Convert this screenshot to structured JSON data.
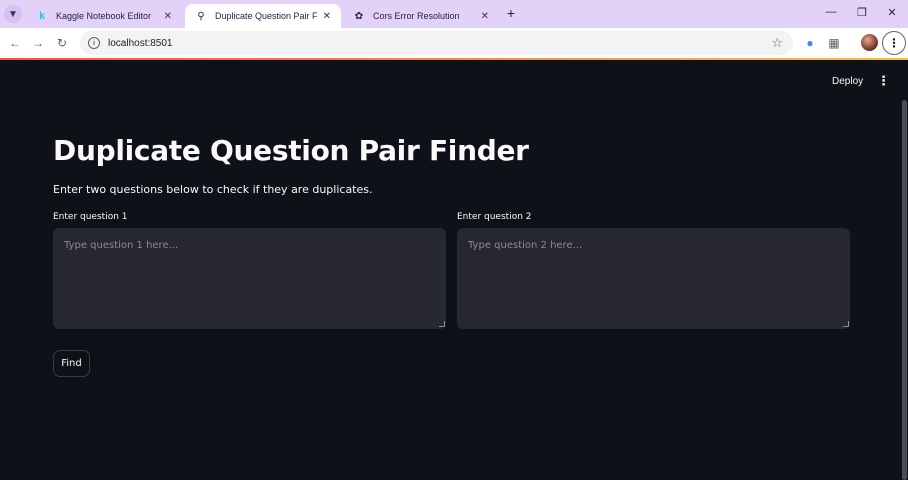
{
  "browser": {
    "tabs": [
      {
        "label": "Kaggle Notebook Editor",
        "favicon": "kaggle-k-icon",
        "active": false
      },
      {
        "label": "Duplicate Question Pair Finder",
        "favicon": "search-icon",
        "active": true
      },
      {
        "label": "Cors Error Resolution",
        "favicon": "openai-icon",
        "active": false
      }
    ],
    "url": "localhost:8501",
    "colors": {
      "tabstrip": "#e3d2f7",
      "toolbar": "#ffffff"
    }
  },
  "app": {
    "deploy_label": "Deploy",
    "title": "Duplicate Question Pair Finder",
    "subtitle": "Enter two questions below to check if they are duplicates.",
    "question1": {
      "label": "Enter question 1",
      "placeholder": "Type question 1 here...",
      "value": ""
    },
    "question2": {
      "label": "Enter question 2",
      "placeholder": "Type question 2 here...",
      "value": ""
    },
    "find_label": "Find",
    "colors": {
      "background": "#0e1117",
      "input": "#262730",
      "text": "#fafafa"
    }
  }
}
